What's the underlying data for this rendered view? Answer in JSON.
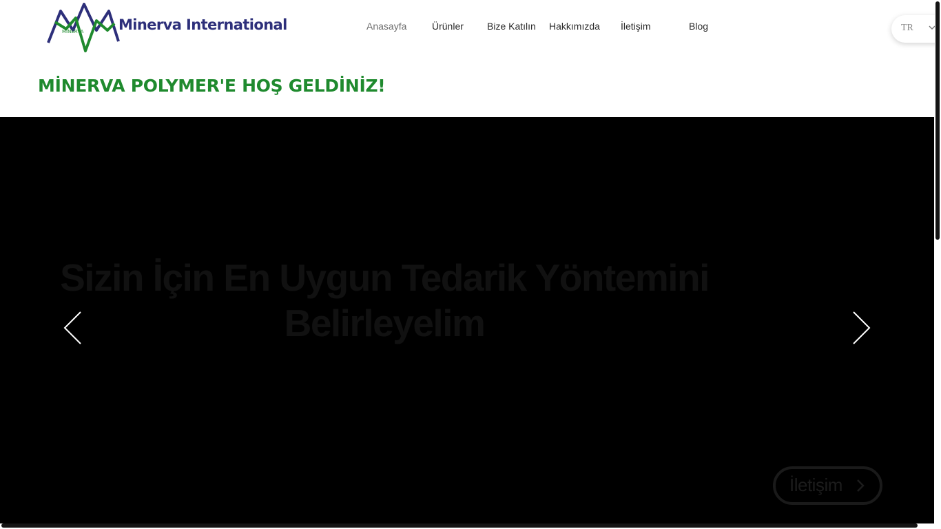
{
  "header": {
    "logo_icon": "minerva-mountain-logo",
    "logo_text": "MINERVA",
    "brand_name": "Minerva International",
    "nav": [
      {
        "label": "Anasayfa",
        "active": true
      },
      {
        "label": "Ürünler",
        "active": false
      },
      {
        "label": "Bize Katılın",
        "active": false
      },
      {
        "label": "Hakkımızda",
        "active": false
      },
      {
        "label": "İletişim",
        "active": false
      },
      {
        "label": "Blog",
        "active": false
      }
    ],
    "language": {
      "selected": "TR",
      "icon": "chevron-down-icon"
    }
  },
  "welcome": {
    "text": "MİNERVA POLYMER'E HOŞ GELDİNİZ!"
  },
  "hero": {
    "title_line1": "Sizin İçin En Uygun Tedarik Yöntemini",
    "title_line2": "Belirleyelim",
    "prev_icon": "chevron-left-icon",
    "next_icon": "chevron-right-icon",
    "cta_label": "İletişim",
    "cta_icon": "chevron-right-icon"
  },
  "colors": {
    "brand_navy": "#2d2f7a",
    "brand_green": "#1f8a2e",
    "hero_background": "#000000"
  }
}
